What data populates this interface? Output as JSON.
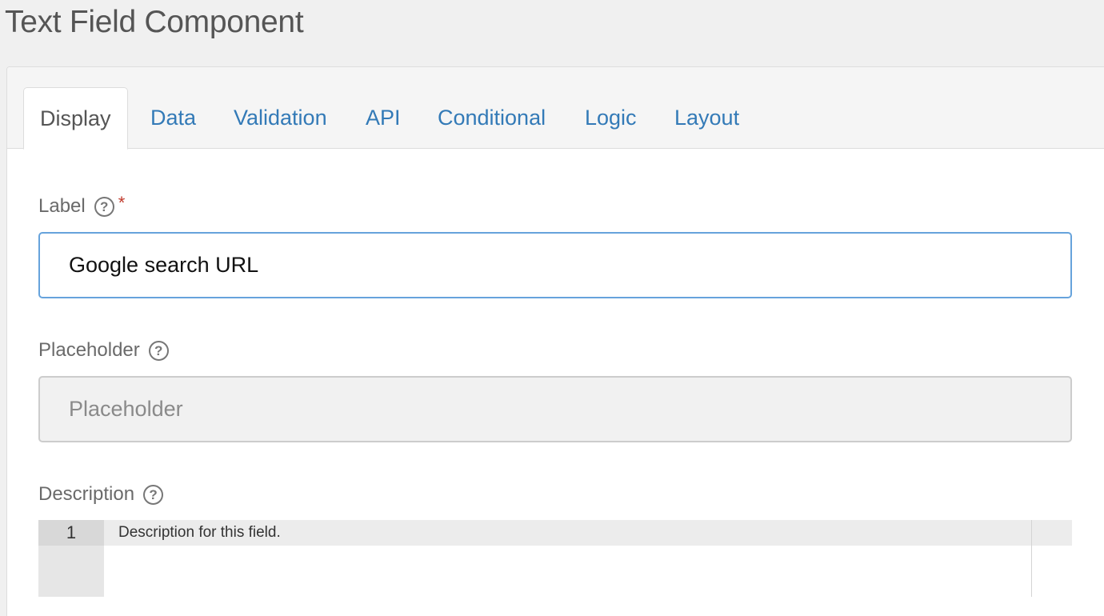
{
  "page": {
    "title": "Text Field Component"
  },
  "tabs": [
    {
      "label": "Display",
      "active": true
    },
    {
      "label": "Data",
      "active": false
    },
    {
      "label": "Validation",
      "active": false
    },
    {
      "label": "API",
      "active": false
    },
    {
      "label": "Conditional",
      "active": false
    },
    {
      "label": "Logic",
      "active": false
    },
    {
      "label": "Layout",
      "active": false
    }
  ],
  "fields": {
    "label": {
      "title": "Label",
      "help_icon": "?",
      "required_marker": "*",
      "value": "Google search URL"
    },
    "placeholder": {
      "title": "Placeholder",
      "help_icon": "?",
      "placeholder_text": "Placeholder"
    },
    "description": {
      "title": "Description",
      "help_icon": "?",
      "line_number": "1",
      "line_text": "Description for this field."
    }
  },
  "colors": {
    "link": "#337ab7",
    "focus_border": "#66a3dc",
    "required": "#c0392b",
    "background": "#f0f0f0"
  },
  "icons": {
    "help": "question-circle-icon"
  }
}
